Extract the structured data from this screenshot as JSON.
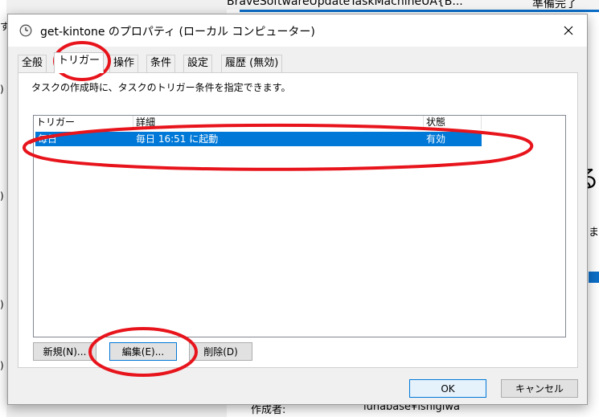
{
  "background": {
    "left_chars": [
      "す",
      ")",
      ")",
      ")",
      ")"
    ],
    "top_text": "BraveSoftwareUpdateTaskMachineUA{B...",
    "top_right": "準備完了",
    "right_big": "る",
    "right_small": "ま",
    "created_by_label": "作成者:",
    "created_by_value": "lunabase¥ishigiwa"
  },
  "window": {
    "title": "get-kintone のプロパティ (ローカル コンピューター)",
    "icon": "clock-icon",
    "close_icon": "close-icon"
  },
  "tabs": [
    {
      "label": "全般"
    },
    {
      "label": "トリガー"
    },
    {
      "label": "操作"
    },
    {
      "label": "条件"
    },
    {
      "label": "設定"
    },
    {
      "label": "履歴 (無効)"
    }
  ],
  "panel": {
    "description": "タスクの作成時に、タスクのトリガー条件を指定できます。"
  },
  "trigger_list": {
    "columns": [
      "トリガー",
      "詳細",
      "状態"
    ],
    "rows": [
      {
        "trigger": "毎日",
        "detail": "毎日 16:51 に起動",
        "status": "有効"
      }
    ]
  },
  "buttons": {
    "new": "新規(N)...",
    "edit": "編集(E)...",
    "delete": "削除(D)",
    "ok": "OK",
    "cancel": "キャンセル"
  },
  "colors": {
    "selection": "#0078d7",
    "annotation": "#e8141c"
  }
}
